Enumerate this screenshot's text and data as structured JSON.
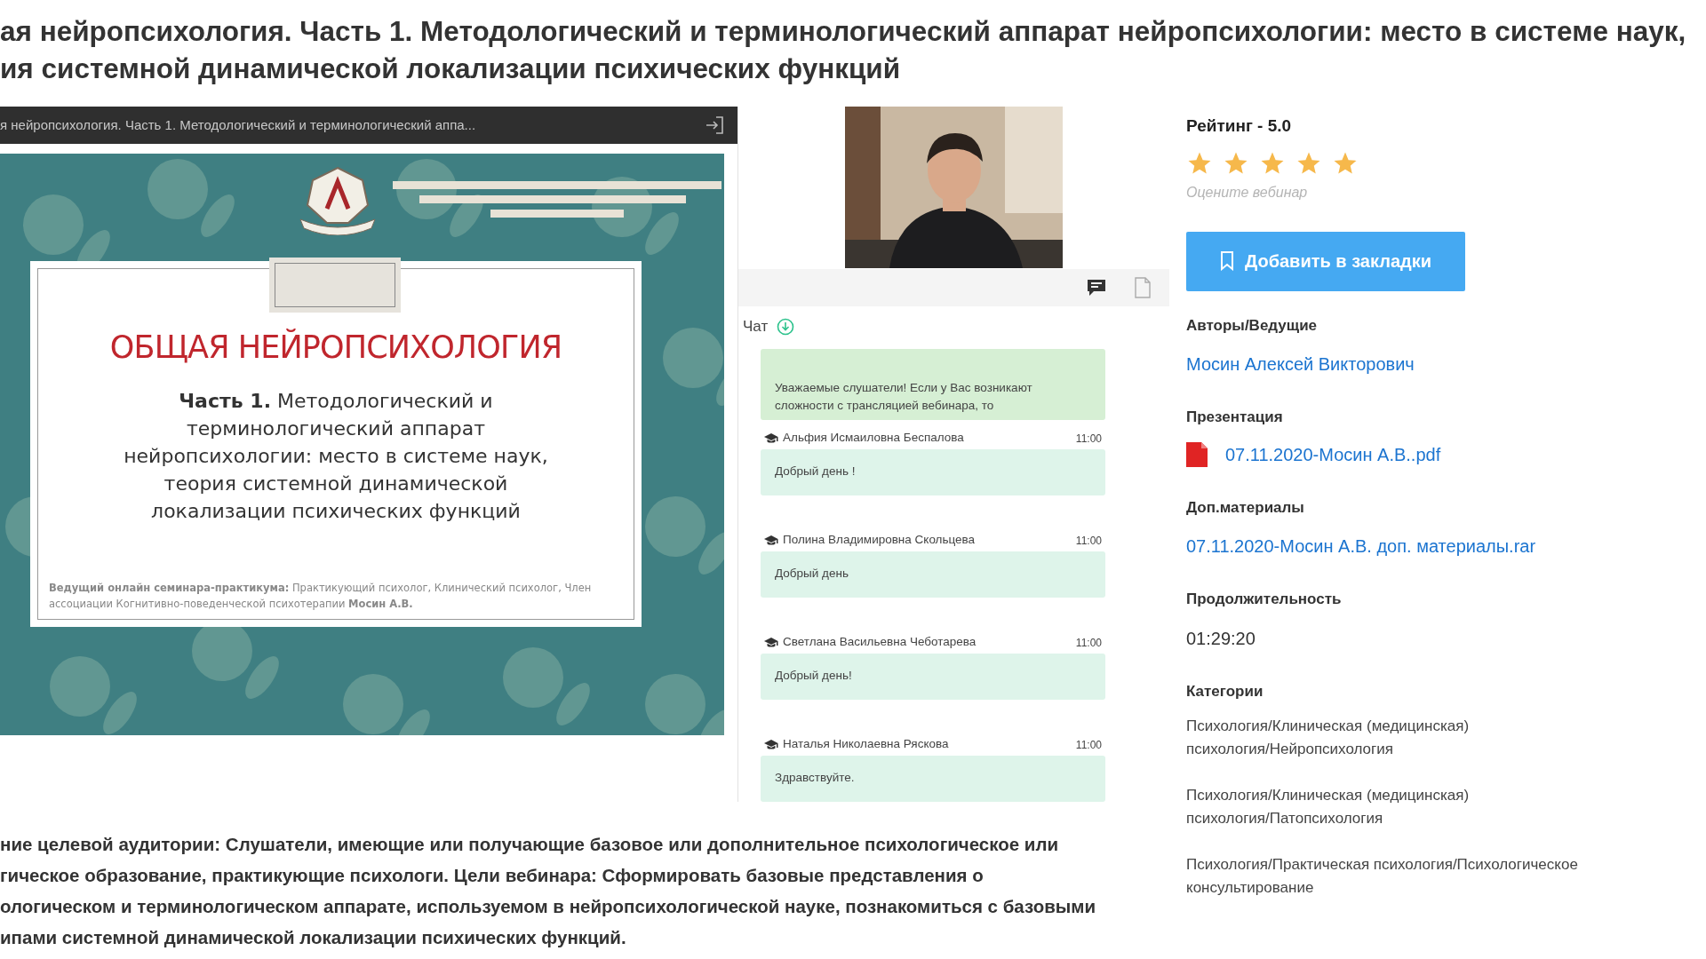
{
  "title": "ая нейропсихология. Часть 1. Методологический и терминологический аппарат нейропсихологии: место в системе наук,\nия системной динамической локализации психических функций",
  "player": {
    "title": "я нейропсихология. Часть 1. Методологический и терминологический аппа...",
    "slide": {
      "heading": "ОБЩАЯ НЕЙРОПСИХОЛОГИЯ",
      "subtitle": "**Часть 1.** Методологический и\nтерминологический аппарат\nнейропсихологии: место в системе наук,\nтеория системной динамической\nлокализации психических функций",
      "footer": "**Ведущий онлайн семинара-практикума:** Практикующий психолог, Клинический психолог, Член ассоциации Когнитивно-поведенческой психотерапии **Мосин А.В.**"
    }
  },
  "chat": {
    "label": "Чат",
    "messages": [
      {
        "kind": "notice",
        "text": "Уважаемые слушатели! Если у Вас возникают сложности с трансляцией вебинара, то"
      },
      {
        "kind": "message",
        "author": "Альфия Исмаиловна Беспалова",
        "time": "11:00",
        "text": "Добрый день !"
      },
      {
        "kind": "message",
        "author": "Полина Владимировна Скольцева",
        "time": "11:00",
        "text": "Добрый день"
      },
      {
        "kind": "message",
        "author": "Светлана Васильевна Чеботарева",
        "time": "11:00",
        "text": "Добрый день!"
      },
      {
        "kind": "message",
        "author": "Наталья Николаевна Ряскова",
        "time": "11:00",
        "text": "Здравствуйте."
      }
    ]
  },
  "rating": {
    "label": "Рейтинг - 5.0",
    "stars": 5,
    "hint": "Оцените вебинар"
  },
  "bookmark_button": "Добавить в закладки",
  "sections": [
    {
      "kind": "link",
      "heading": "Авторы/Ведущие",
      "items": [
        "Мосин Алексей Викторович"
      ]
    },
    {
      "kind": "file",
      "heading": "Презентация",
      "items": [
        "07.11.2020-Мосин А.В..pdf"
      ]
    },
    {
      "kind": "link",
      "heading": "Доп.материалы",
      "items": [
        "07.11.2020-Мосин А.В. доп. материалы.rar"
      ]
    },
    {
      "kind": "text",
      "heading": "Продолжительность",
      "items": [
        "01:29:20"
      ]
    },
    {
      "kind": "list",
      "heading": "Категории",
      "items": [
        "Психология/Клиническая (медицинская)\nпсихология/Нейропсихология",
        "Психология/Клиническая (медицинская)\nпсихология/Патопсихология",
        "Психология/Практическая психология/Психологическое\nконсультирование"
      ]
    }
  ],
  "description": "ние целевой аудитории: Слушатели, имеющие или получающие базовое или дополнительное психологическое или\nгическое образование, практикующие психологи. Цели вебинара: Сформировать базовые представления о\nологическом и терминологическом аппарате, используемом в нейропсихологической науке, познакомиться с базовыми\nипами системной динамической локализации психических функций."
}
